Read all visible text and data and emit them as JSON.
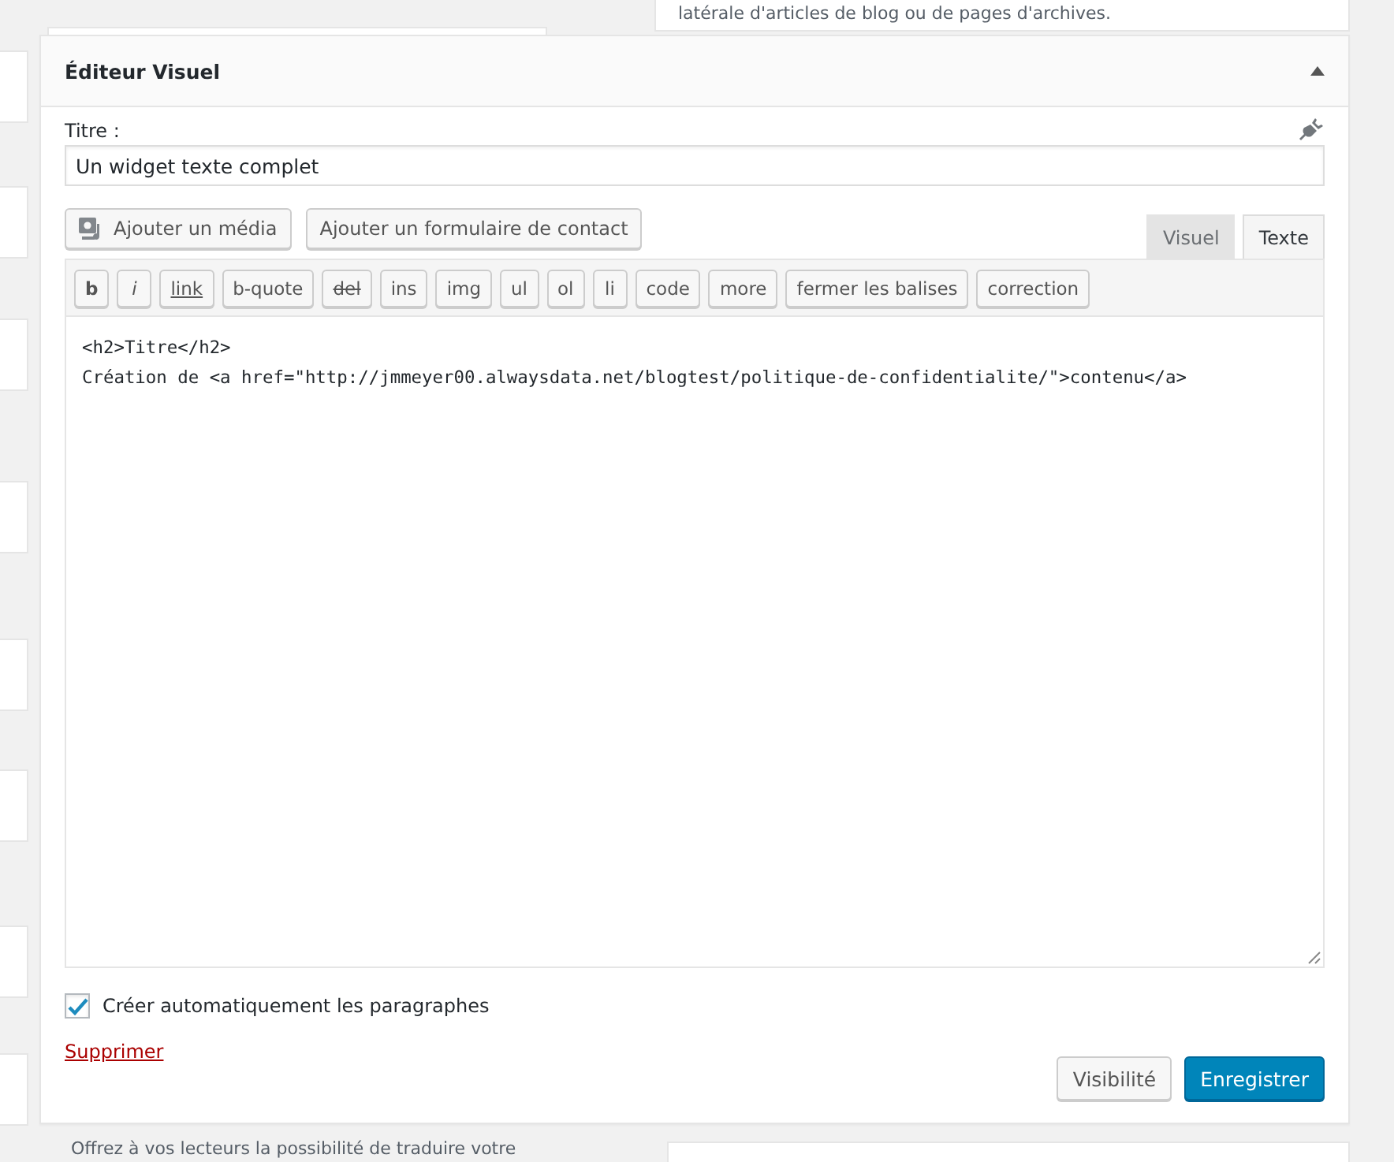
{
  "background": {
    "top_note": "latérale d'articles de blog ou de pages d'archives.",
    "bottom_note": "Offrez à vos lecteurs la possibilité de traduire votre"
  },
  "widget": {
    "title": "Éditeur Visuel",
    "expanded": true,
    "title_label": "Titre :",
    "title_value": "Un widget texte complet",
    "media_buttons": [
      {
        "label": "Ajouter un média",
        "kind": "media"
      },
      {
        "label": "Ajouter un formulaire de contact",
        "kind": "plain"
      }
    ],
    "tabs": [
      {
        "label": "Visuel",
        "selected": false
      },
      {
        "label": "Texte",
        "selected": true
      }
    ],
    "toolbar": [
      {
        "label": "b",
        "kind": "bold"
      },
      {
        "label": "i",
        "kind": "italic"
      },
      {
        "label": "link",
        "kind": "underline"
      },
      {
        "label": "b-quote",
        "kind": "plain"
      },
      {
        "label": "del",
        "kind": "strike"
      },
      {
        "label": "ins",
        "kind": "plain"
      },
      {
        "label": "img",
        "kind": "plain"
      },
      {
        "label": "ul",
        "kind": "plain"
      },
      {
        "label": "ol",
        "kind": "plain"
      },
      {
        "label": "li",
        "kind": "plain"
      },
      {
        "label": "code",
        "kind": "plain"
      },
      {
        "label": "more",
        "kind": "plain"
      },
      {
        "label": "fermer les balises",
        "kind": "plain"
      },
      {
        "label": "correction",
        "kind": "plain"
      }
    ],
    "content": [
      "<h2>Titre</h2>",
      "Création de <a href=\"http://jmmeyer00.alwaysdata.net/blogtest/politique-de-confidentialite/\">contenu</a>"
    ],
    "auto_paragraphs": {
      "label": "Créer automatiquement les paragraphes",
      "checked": true
    },
    "delete_link": "Supprimer",
    "buttons": [
      {
        "label": "Visibilité",
        "kind": "secondary"
      },
      {
        "label": "Enregistrer",
        "kind": "primary"
      }
    ]
  }
}
